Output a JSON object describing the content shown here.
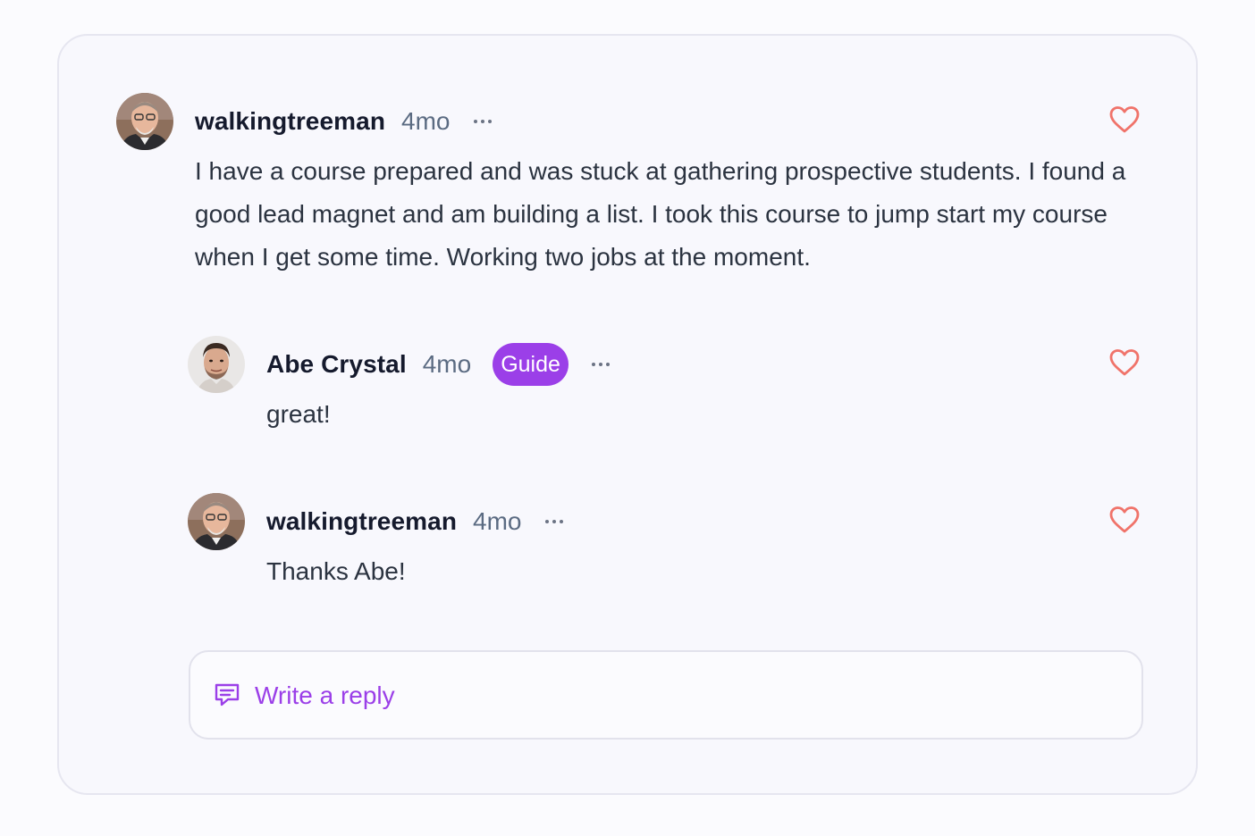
{
  "thread": {
    "main_comment": {
      "author": "walkingtreeman",
      "time": "4mo",
      "text": "I have a course prepared and was stuck at gathering prospective students. I found a good lead magnet and am building a list. I took this course to jump start my course when I get some time. Working two jobs at the moment."
    },
    "replies": [
      {
        "author": "Abe Crystal",
        "time": "4mo",
        "badge": "Guide",
        "text": "great!"
      },
      {
        "author": "walkingtreeman",
        "time": "4mo",
        "text": "Thanks Abe!"
      }
    ],
    "reply_prompt": "Write a reply"
  },
  "icons": {
    "more": "ellipsis-horizontal-icon",
    "like": "heart-outline-icon",
    "reply": "message-square-icon"
  },
  "colors": {
    "accent": "#9b3fe8",
    "heart": "#f0736a",
    "author": "#151a2d",
    "timestamp": "#5b6b82"
  }
}
